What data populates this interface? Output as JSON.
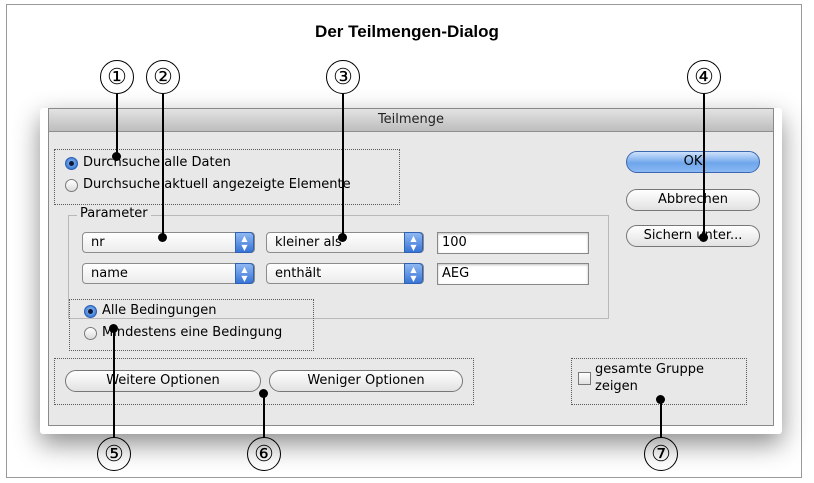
{
  "figure": {
    "title": "Der Teilmengen-Dialog",
    "callouts": [
      "①",
      "②",
      "③",
      "④",
      "⑤",
      "⑥",
      "⑦"
    ]
  },
  "dialog": {
    "title": "Teilmenge",
    "scope": {
      "options": [
        "Durchsuche alle Daten",
        "Durchsuche aktuell angezeigte Elemente"
      ],
      "selected": "Durchsuche alle Daten"
    },
    "parameters": {
      "label": "Parameter",
      "rows": [
        {
          "field": "nr",
          "operator": "kleiner als",
          "value": "100"
        },
        {
          "field": "name",
          "operator": "enthält",
          "value": "AEG"
        }
      ]
    },
    "conditions": {
      "options": [
        "Alle Bedingungen",
        "Mindestens eine Bedingung"
      ],
      "selected": "Alle Bedingungen"
    },
    "buttons": {
      "ok": "OK",
      "cancel": "Abbrechen",
      "save_as": "Sichern unter...",
      "more_options": "Weitere Optionen",
      "fewer_options": "Weniger Optionen"
    },
    "whole_group": {
      "label_line1": "gesamte Gruppe",
      "label_line2": "zeigen",
      "checked": false
    }
  }
}
